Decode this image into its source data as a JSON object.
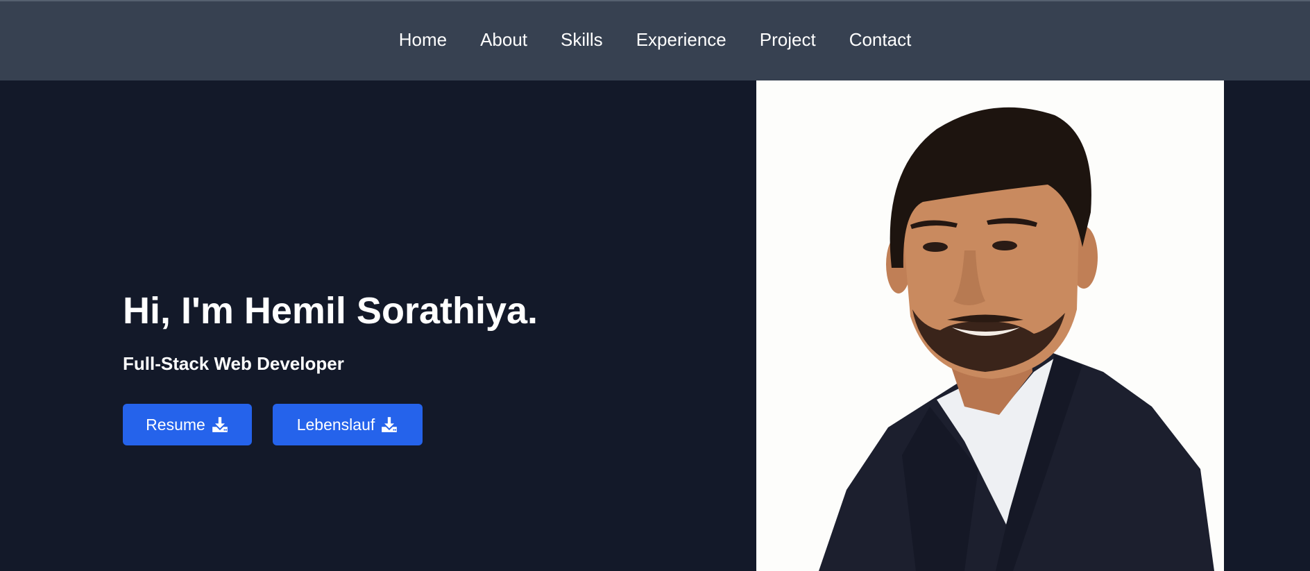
{
  "nav": {
    "items": [
      {
        "label": "Home"
      },
      {
        "label": "About"
      },
      {
        "label": "Skills"
      },
      {
        "label": "Experience"
      },
      {
        "label": "Project"
      },
      {
        "label": "Contact"
      }
    ]
  },
  "hero": {
    "title": "Hi, I'm Hemil Sorathiya.",
    "subtitle": "Full-Stack Web Developer",
    "buttons": {
      "resume_label": "Resume",
      "lebenslauf_label": "Lebenslauf"
    }
  },
  "colors": {
    "nav_bg": "#374151",
    "page_bg": "#131929",
    "button": "#2563eb",
    "text": "#ffffff"
  },
  "icons": {
    "download": "download-icon"
  }
}
